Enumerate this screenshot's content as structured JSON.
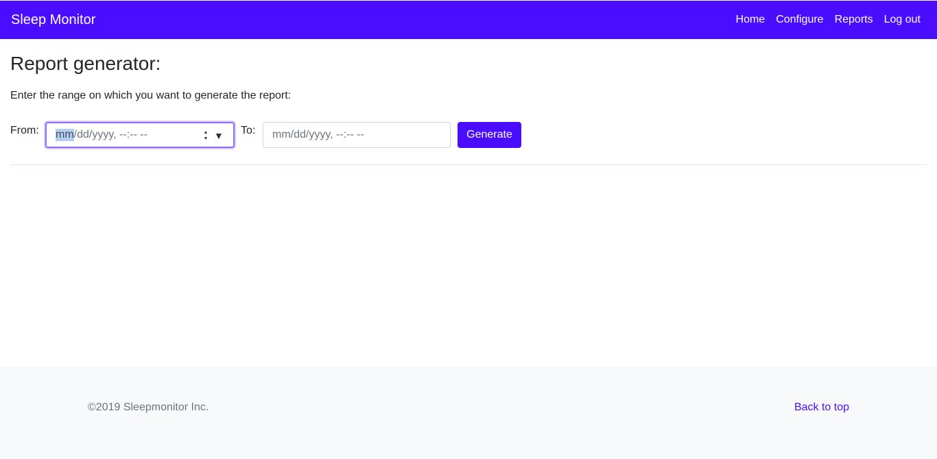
{
  "navbar": {
    "brand": "Sleep Monitor",
    "links": [
      "Home",
      "Configure",
      "Reports",
      "Log out"
    ],
    "bg_color": "#4a0dff"
  },
  "main": {
    "title": "Report generator:",
    "intro": "Enter the range on which you want to generate the report:",
    "from_label": "From:",
    "to_label": "To:",
    "from_input": {
      "highlighted_segment": "mm",
      "rest": "/dd/yyyy, --:-- --",
      "spinner_up": "▲",
      "spinner_down": "▼",
      "dropdown": "▼"
    },
    "to_input": {
      "placeholder": "mm/dd/yyyy, --:-- --"
    },
    "generate_label": "Generate"
  },
  "footer": {
    "copyright": "©2019 Sleepmonitor Inc.",
    "back_to_top": "Back to top"
  }
}
